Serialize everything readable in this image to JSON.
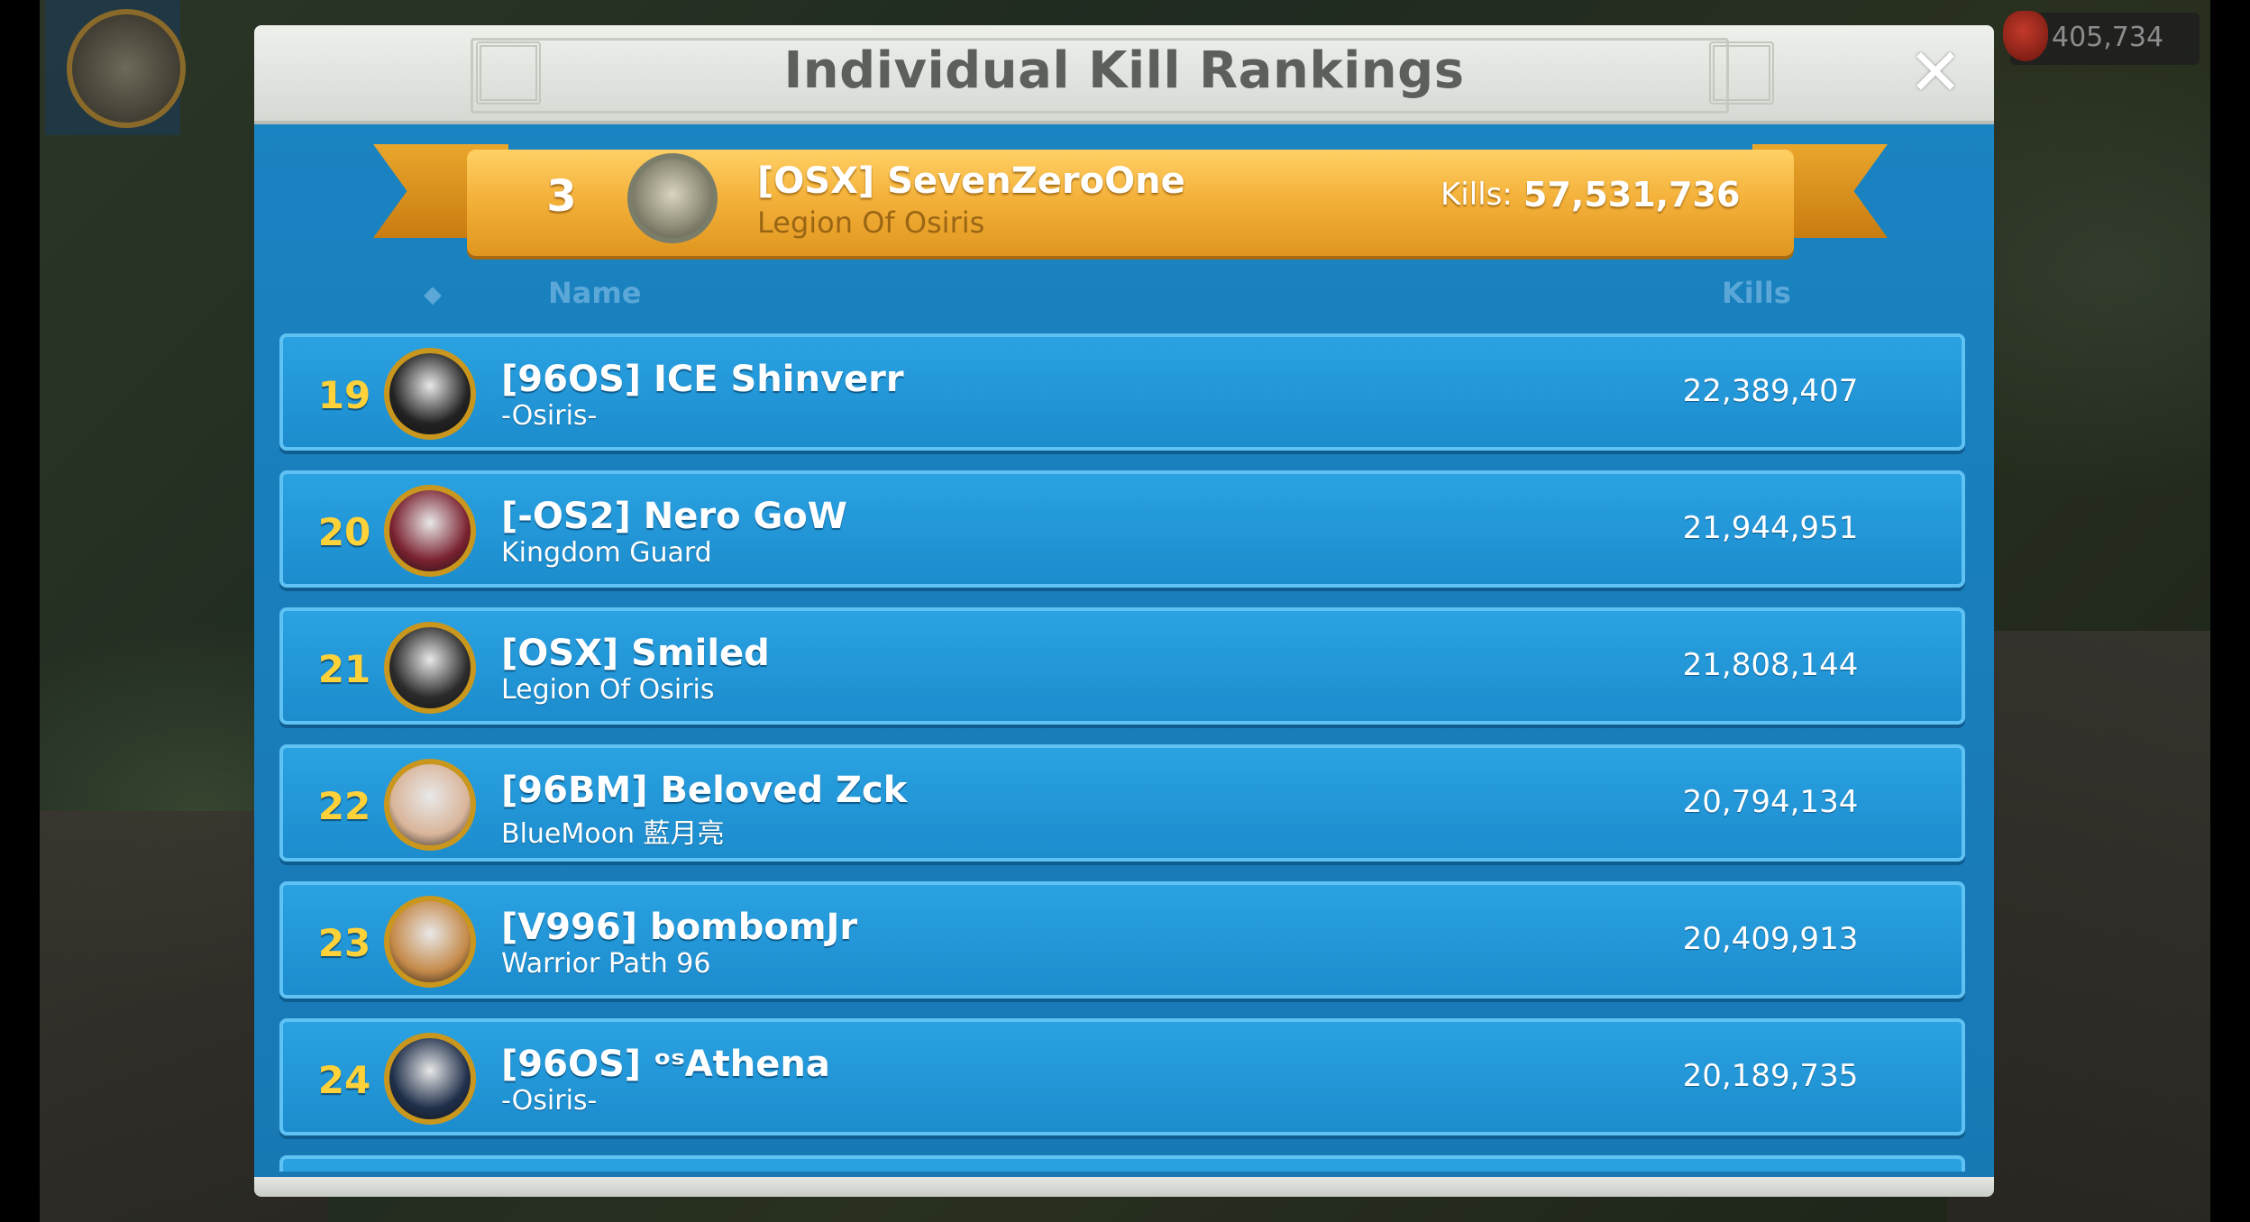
{
  "background": {
    "resource_value": "405,734"
  },
  "dialog": {
    "title": "Individual Kill Rankings",
    "close_icon": "close-icon"
  },
  "my_rank": {
    "rank": "3",
    "name": "[OSX] SevenZeroOne",
    "alliance": "Legion Of Osiris",
    "kills_label": "Kills:",
    "kills": "57,531,736"
  },
  "columns": {
    "rank_marker": "◆",
    "name": "Name",
    "kills": "Kills"
  },
  "rows": [
    {
      "rank": "19",
      "name": "[96OS] ICE Shinverr",
      "alliance": "-Osiris-",
      "kills": "22,389,407",
      "avatar_color": "#222222"
    },
    {
      "rank": "20",
      "name": "[-OS2] Nero GoW",
      "alliance": "Kingdom Guard",
      "kills": "21,944,951",
      "avatar_color": "#7a2230"
    },
    {
      "rank": "21",
      "name": "[OSX] Smiled",
      "alliance": "Legion Of Osiris",
      "kills": "21,808,144",
      "avatar_color": "#2b2b2b"
    },
    {
      "rank": "22",
      "name": "[96BM] Beloved Zck",
      "alliance": "BlueMoon 藍月亮",
      "kills": "20,794,134",
      "avatar_color": "#d9b59a"
    },
    {
      "rank": "23",
      "name": "[V996] bombomJr",
      "alliance": "Warrior Path 96",
      "kills": "20,409,913",
      "avatar_color": "#c58a4a"
    },
    {
      "rank": "24",
      "name": "[96OS] ᵒˢAthena",
      "alliance": "-Osiris-",
      "kills": "20,189,735",
      "avatar_color": "#1f2f4a"
    }
  ],
  "colors": {
    "panel_blue": "#1a84c2",
    "row_blue": "#2aa2e2",
    "rank_gold": "#ffd23a",
    "ribbon_gold": "#f4b23b"
  }
}
